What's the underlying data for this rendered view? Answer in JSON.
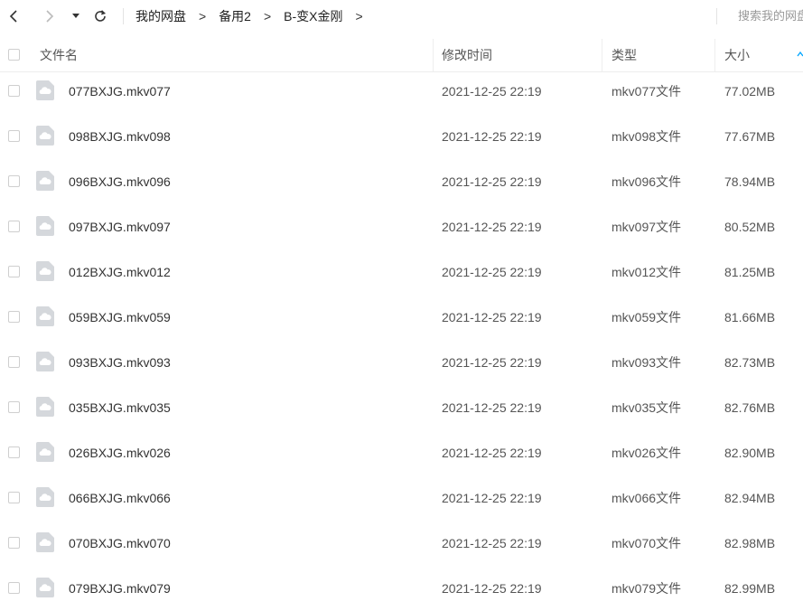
{
  "toolbar": {
    "back_icon": "chevron-left-icon",
    "forward_icon": "chevron-right-icon",
    "history_icon": "caret-down-icon",
    "refresh_icon": "refresh-icon",
    "breadcrumb": [
      "我的网盘",
      "备用2",
      "B-变X金刚"
    ],
    "crumb_separator": ">",
    "search_placeholder": "搜索我的网盘文件"
  },
  "table": {
    "columns": {
      "name": "文件名",
      "modified": "修改时间",
      "type": "类型",
      "size": "大小"
    },
    "rows": [
      {
        "name": "077BXJG.mkv077",
        "modified": "2021-12-25 22:19",
        "type": "mkv077文件",
        "size": "77.02MB"
      },
      {
        "name": "098BXJG.mkv098",
        "modified": "2021-12-25 22:19",
        "type": "mkv098文件",
        "size": "77.67MB"
      },
      {
        "name": "096BXJG.mkv096",
        "modified": "2021-12-25 22:19",
        "type": "mkv096文件",
        "size": "78.94MB"
      },
      {
        "name": "097BXJG.mkv097",
        "modified": "2021-12-25 22:19",
        "type": "mkv097文件",
        "size": "80.52MB"
      },
      {
        "name": "012BXJG.mkv012",
        "modified": "2021-12-25 22:19",
        "type": "mkv012文件",
        "size": "81.25MB"
      },
      {
        "name": "059BXJG.mkv059",
        "modified": "2021-12-25 22:19",
        "type": "mkv059文件",
        "size": "81.66MB"
      },
      {
        "name": "093BXJG.mkv093",
        "modified": "2021-12-25 22:19",
        "type": "mkv093文件",
        "size": "82.73MB"
      },
      {
        "name": "035BXJG.mkv035",
        "modified": "2021-12-25 22:19",
        "type": "mkv035文件",
        "size": "82.76MB"
      },
      {
        "name": "026BXJG.mkv026",
        "modified": "2021-12-25 22:19",
        "type": "mkv026文件",
        "size": "82.90MB"
      },
      {
        "name": "066BXJG.mkv066",
        "modified": "2021-12-25 22:19",
        "type": "mkv066文件",
        "size": "82.94MB"
      },
      {
        "name": "070BXJG.mkv070",
        "modified": "2021-12-25 22:19",
        "type": "mkv070文件",
        "size": "82.98MB"
      },
      {
        "name": "079BXJG.mkv079",
        "modified": "2021-12-25 22:19",
        "type": "mkv079文件",
        "size": "82.99MB"
      }
    ]
  },
  "colors": {
    "accent": "#06a7ff",
    "icon_gray": "#d5d8dc",
    "divider": "#eeeeee"
  },
  "icons": {
    "file": "cloud-file-icon",
    "sort": "sort-arrow-icon"
  }
}
